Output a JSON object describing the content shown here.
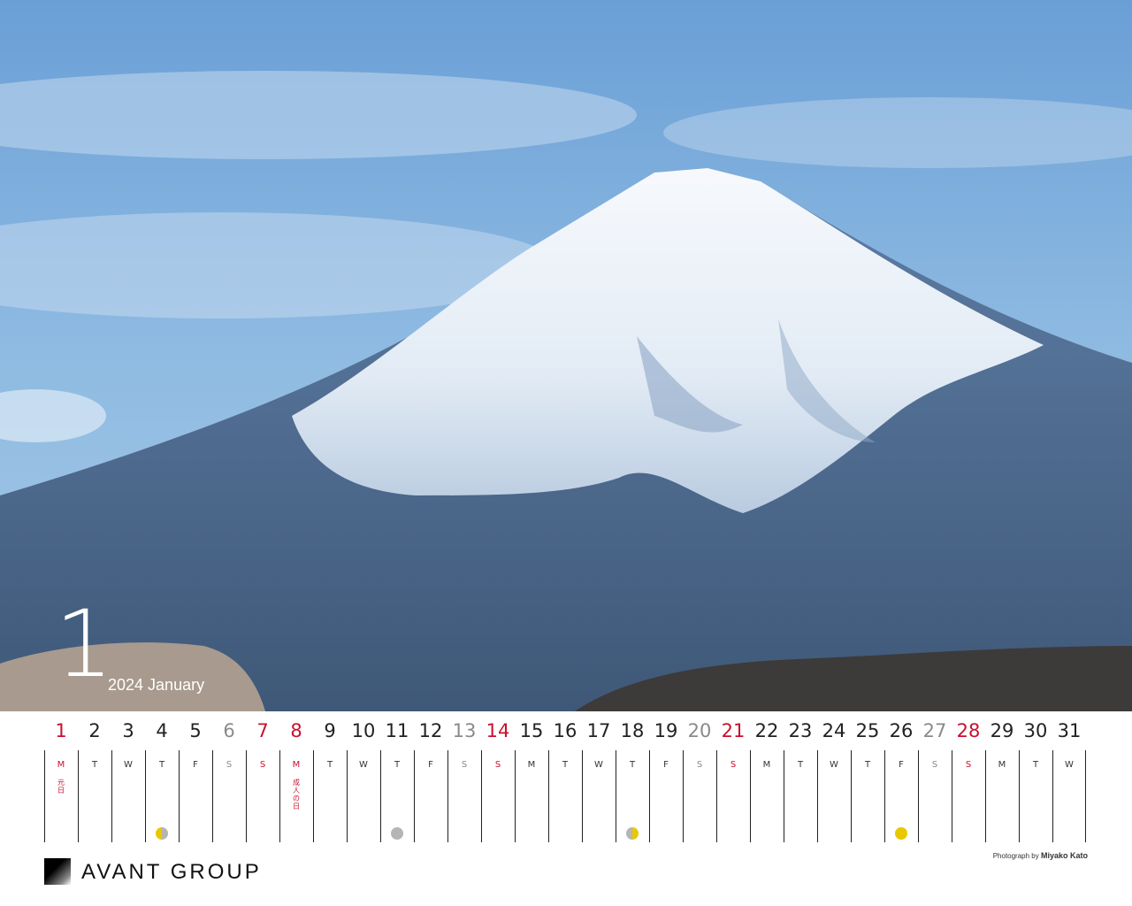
{
  "month": {
    "number": "1",
    "subtitle": "2024 January"
  },
  "brand": {
    "name": "AVANT GROUP"
  },
  "credit": {
    "prefix": "Photograph by",
    "name": "Miyako Kato"
  },
  "colors": {
    "holiday": "#c8102e",
    "saturday": "#8a8a8a",
    "moon_yellow": "#e8c800",
    "moon_gray": "#b5b5b5"
  },
  "days": [
    {
      "n": "1",
      "wd": "M",
      "type": "holiday",
      "hol": "元日"
    },
    {
      "n": "2",
      "wd": "T",
      "type": ""
    },
    {
      "n": "3",
      "wd": "W",
      "type": ""
    },
    {
      "n": "4",
      "wd": "T",
      "type": "",
      "moon": "last"
    },
    {
      "n": "5",
      "wd": "F",
      "type": ""
    },
    {
      "n": "6",
      "wd": "S",
      "type": "sat"
    },
    {
      "n": "7",
      "wd": "S",
      "type": "sun"
    },
    {
      "n": "8",
      "wd": "M",
      "type": "holiday",
      "hol": "成人の日"
    },
    {
      "n": "9",
      "wd": "T",
      "type": ""
    },
    {
      "n": "10",
      "wd": "W",
      "type": ""
    },
    {
      "n": "11",
      "wd": "T",
      "type": "",
      "moon": "new"
    },
    {
      "n": "12",
      "wd": "F",
      "type": ""
    },
    {
      "n": "13",
      "wd": "S",
      "type": "sat"
    },
    {
      "n": "14",
      "wd": "S",
      "type": "sun"
    },
    {
      "n": "15",
      "wd": "M",
      "type": ""
    },
    {
      "n": "16",
      "wd": "T",
      "type": ""
    },
    {
      "n": "17",
      "wd": "W",
      "type": ""
    },
    {
      "n": "18",
      "wd": "T",
      "type": "",
      "moon": "first"
    },
    {
      "n": "19",
      "wd": "F",
      "type": ""
    },
    {
      "n": "20",
      "wd": "S",
      "type": "sat"
    },
    {
      "n": "21",
      "wd": "S",
      "type": "sun"
    },
    {
      "n": "22",
      "wd": "M",
      "type": ""
    },
    {
      "n": "23",
      "wd": "T",
      "type": ""
    },
    {
      "n": "24",
      "wd": "W",
      "type": ""
    },
    {
      "n": "25",
      "wd": "T",
      "type": ""
    },
    {
      "n": "26",
      "wd": "F",
      "type": "",
      "moon": "full"
    },
    {
      "n": "27",
      "wd": "S",
      "type": "sat"
    },
    {
      "n": "28",
      "wd": "S",
      "type": "sun"
    },
    {
      "n": "29",
      "wd": "M",
      "type": ""
    },
    {
      "n": "30",
      "wd": "T",
      "type": ""
    },
    {
      "n": "31",
      "wd": "W",
      "type": ""
    }
  ]
}
